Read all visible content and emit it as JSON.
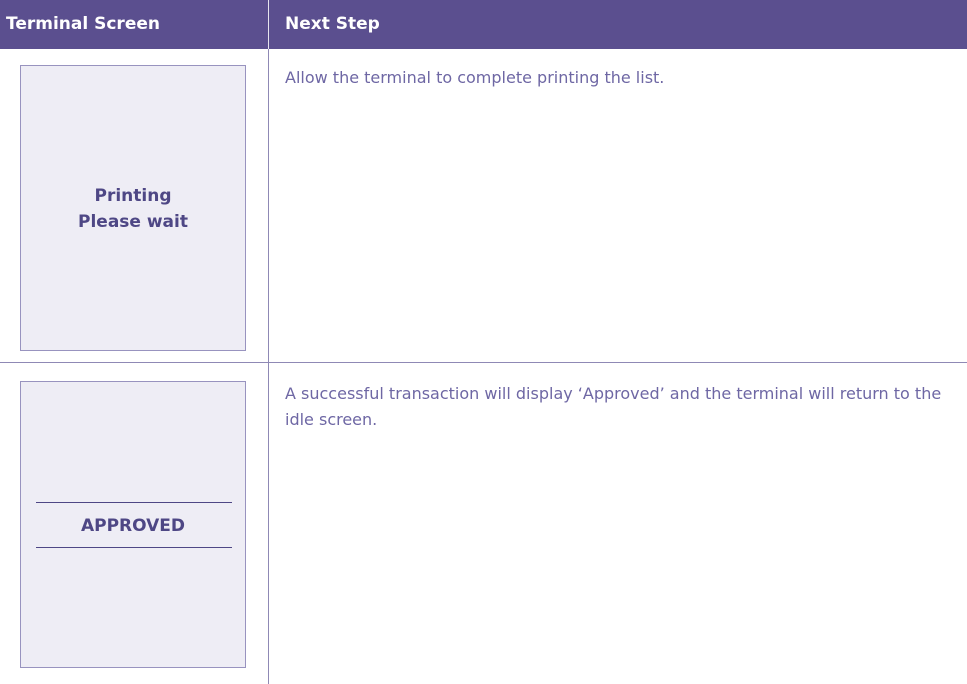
{
  "table": {
    "headers": {
      "terminal_screen": "Terminal Screen",
      "next_step": "Next Step"
    },
    "rows": [
      {
        "screen_lines": [
          "Printing",
          "Please wait"
        ],
        "next_step": "Allow the terminal to complete printing the list."
      },
      {
        "screen_lines": [
          "APPROVED"
        ],
        "next_step": "A successful transaction will display ‘Approved’ and the terminal will return to the idle screen."
      }
    ]
  },
  "colors": {
    "header_bg": "#5b4f8f",
    "screen_bg": "#eeedf5",
    "screen_text": "#4e4785",
    "body_text": "#6e67a4"
  }
}
